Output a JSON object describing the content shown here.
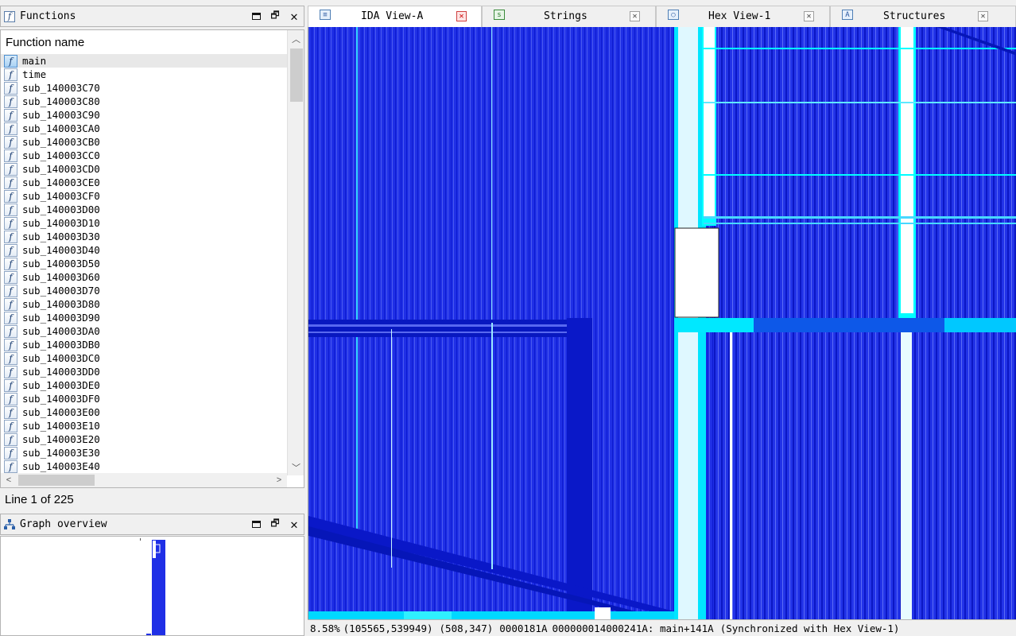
{
  "functions_panel": {
    "title": "Functions",
    "icon": "function-icon",
    "column_header": "Function name",
    "rows": [
      "main",
      "time",
      "sub_140003C70",
      "sub_140003C80",
      "sub_140003C90",
      "sub_140003CA0",
      "sub_140003CB0",
      "sub_140003CC0",
      "sub_140003CD0",
      "sub_140003CE0",
      "sub_140003CF0",
      "sub_140003D00",
      "sub_140003D10",
      "sub_140003D30",
      "sub_140003D40",
      "sub_140003D50",
      "sub_140003D60",
      "sub_140003D70",
      "sub_140003D80",
      "sub_140003D90",
      "sub_140003DA0",
      "sub_140003DB0",
      "sub_140003DC0",
      "sub_140003DD0",
      "sub_140003DE0",
      "sub_140003DF0",
      "sub_140003E00",
      "sub_140003E10",
      "sub_140003E20",
      "sub_140003E30",
      "sub_140003E40"
    ],
    "selected_index": 0,
    "status": "Line 1 of 225"
  },
  "graph_overview_panel": {
    "title": "Graph overview",
    "icon": "graph-tree-icon"
  },
  "tabs": [
    {
      "label": "IDA View-A",
      "icon": "ida-view-icon",
      "active": true
    },
    {
      "label": "Strings",
      "icon": "strings-icon",
      "active": false
    },
    {
      "label": "Hex View-1",
      "icon": "hex-view-icon",
      "active": false
    },
    {
      "label": "Structures",
      "icon": "structures-icon",
      "active": false
    }
  ],
  "ida_view": {
    "status_zoom": "8.58%",
    "status_coords": "(105565,539949)",
    "status_cursor": "(508,347)",
    "status_offset": "0000181A",
    "status_address": "000000014000241A: main+141A",
    "status_sync": "(Synchronized with Hex View-1)",
    "colors": {
      "node_blue": "#1f2fe6",
      "edge_dark": "#0a18c8",
      "highlight_cyan": "#00ffff",
      "white_block": "#ffffff"
    }
  }
}
